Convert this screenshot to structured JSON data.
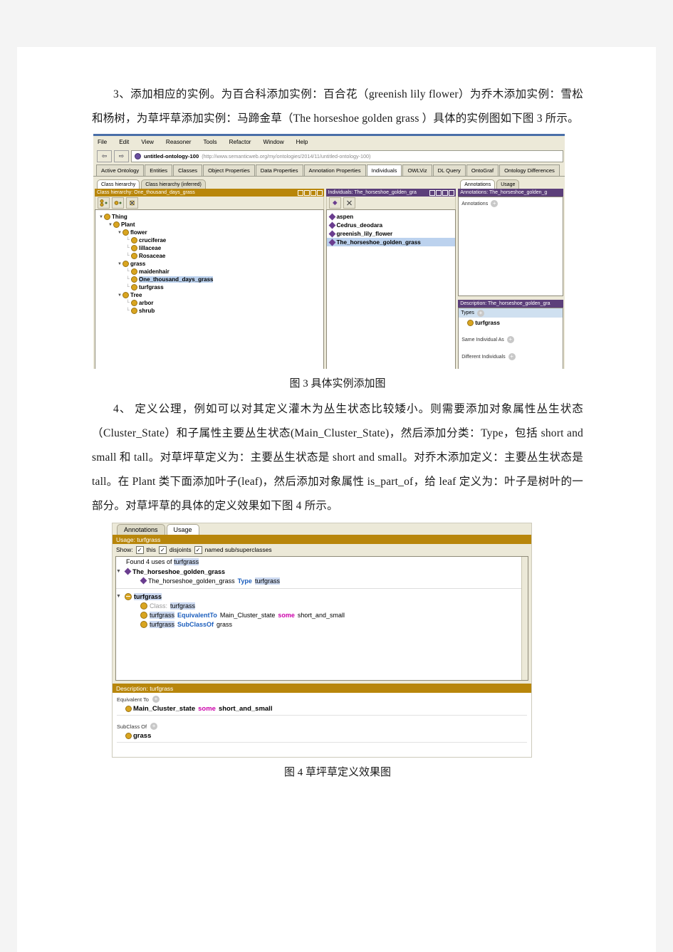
{
  "document": {
    "paragraphs": [
      {
        "id": "para-3",
        "runs": [
          {
            "t": "indent",
            "v": ""
          },
          {
            "t": "cn",
            "v": "3、添加相应的实例。为百合科添加实例："
          },
          {
            "t": "cn",
            "v": "百合花（"
          },
          {
            "t": "en",
            "v": "greenish lily flower"
          },
          {
            "t": "cn",
            "v": "）为乔木添加实例：雪松和杨树，为草坪草添加实例：马蹄金草（"
          },
          {
            "t": "en",
            "v": "The horseshoe golden grass"
          },
          {
            "t": "cn",
            "v": "）具体的实例图如下图 3 所示。"
          }
        ],
        "plain": "3、添加相应的实例。为百合科添加实例：百合花（greenish lily flower）为乔木添加实例：雪松和杨树，为草坪草添加实例：马蹄金草（The horseshoe golden grass ）具体的实例图如下图 3 所示。"
      },
      {
        "id": "para-4",
        "plain": "4、 定义公理，例如可以对其定义灌木为丛生状态比较矮小。则需要添加对象属性丛生状态（Cluster_State）和子属性主要丛生状态(Main_Cluster_State)，然后添加分类：Type，包括 short and small 和 tall。对草坪草定义为：主要丛生状态是 short and small。对乔木添加定义：主要丛生状态是 tall。在 Plant 类下面添加叶子(leaf)，然后添加对象属性 is_part_of，给 leaf 定义为：叶子是树叶的一部分。对草坪草的具体的定义效果如下图 4 所示。"
      }
    ],
    "captions": {
      "fig3": "图 3  具体实例添加图",
      "fig4": "图 4  草坪草定义效果图"
    }
  },
  "figure3": {
    "menubar": [
      "File",
      "Edit",
      "View",
      "Reasoner",
      "Tools",
      "Refactor",
      "Window",
      "Help"
    ],
    "nav": {
      "back_icon": "arrow-left-icon",
      "forward_icon": "arrow-right-icon"
    },
    "ontology": {
      "icon": "ontology-icon",
      "name": "untitled-ontology-100",
      "iri": "(http://www.semanticweb.org/my/ontologies/2014/11/untitled-ontology-100)"
    },
    "tabs": [
      {
        "label": "Active Ontology",
        "active": false
      },
      {
        "label": "Entities",
        "active": false
      },
      {
        "label": "Classes",
        "active": false
      },
      {
        "label": "Object Properties",
        "active": false
      },
      {
        "label": "Data Properties",
        "active": false
      },
      {
        "label": "Annotation Properties",
        "active": false
      },
      {
        "label": "Individuals",
        "active": true
      },
      {
        "label": "OWLViz",
        "active": false
      },
      {
        "label": "DL Query",
        "active": false
      },
      {
        "label": "OntoGraf",
        "active": false
      },
      {
        "label": "Ontology Differences",
        "active": false
      }
    ],
    "class_panel": {
      "tabs": [
        {
          "label": "Class hierarchy",
          "active": true
        },
        {
          "label": "Class hierarchy (inferred)",
          "active": false
        }
      ],
      "title": "Class hierarchy: One_thousand_days_grass",
      "toolbar": [
        "add-subclass-icon",
        "add-sibling-class-icon",
        "delete-class-icon"
      ],
      "tree": [
        {
          "label": "Thing",
          "depth": 0,
          "expander": "▼",
          "selected": false
        },
        {
          "label": "Plant",
          "depth": 1,
          "expander": "▼",
          "selected": false
        },
        {
          "label": "flower",
          "depth": 2,
          "expander": "▼",
          "selected": false
        },
        {
          "label": "cruciferae",
          "depth": 3,
          "expander": "",
          "selected": false
        },
        {
          "label": "lillaceae",
          "depth": 3,
          "expander": "",
          "selected": false
        },
        {
          "label": "Rosaceae",
          "depth": 3,
          "expander": "",
          "selected": false
        },
        {
          "label": "grass",
          "depth": 2,
          "expander": "▼",
          "selected": false
        },
        {
          "label": "maidenhair",
          "depth": 3,
          "expander": "",
          "selected": false
        },
        {
          "label": "One_thousand_days_grass",
          "depth": 3,
          "expander": "",
          "selected": true
        },
        {
          "label": "turfgrass",
          "depth": 3,
          "expander": "",
          "selected": false
        },
        {
          "label": "Tree",
          "depth": 2,
          "expander": "▼",
          "selected": false
        },
        {
          "label": "arbor",
          "depth": 3,
          "expander": "",
          "selected": false
        },
        {
          "label": "shrub",
          "depth": 3,
          "expander": "",
          "selected": false
        }
      ]
    },
    "individuals_panel": {
      "title": "Individuals: The_horseshoe_golden_gra",
      "toolbar": [
        "add-individual-icon",
        "delete-individual-icon"
      ],
      "items": [
        {
          "label": "aspen",
          "selected": false
        },
        {
          "label": "Cedrus_deodara",
          "selected": false
        },
        {
          "label": "greenish_lily_flower",
          "selected": false
        },
        {
          "label": "The_horseshoe_golden_grass",
          "selected": true
        }
      ]
    },
    "annotations_panel": {
      "tabs": [
        {
          "label": "Annotations",
          "active": true
        },
        {
          "label": "Usage",
          "active": false
        }
      ],
      "title": "Annotations: The_horseshoe_golden_g",
      "section_label": "Annotations"
    },
    "description_panel": {
      "title": "Description: The_horseshoe_golden_gra",
      "types_label": "Types",
      "types_value": "turfgrass",
      "same_individual_label": "Same Individual As",
      "different_individuals_label": "Different Individuals"
    }
  },
  "figure4": {
    "tabs": [
      {
        "label": "Annotations",
        "active": false
      },
      {
        "label": "Usage",
        "active": true
      }
    ],
    "usage_title": "Usage: turfgrass",
    "show_label": "Show:",
    "show_options": [
      {
        "label": "this",
        "checked": true
      },
      {
        "label": "disjoints",
        "checked": true
      },
      {
        "label": "named sub/superclasses",
        "checked": true
      }
    ],
    "found_prefix": "Found 4 uses of",
    "found_term": "turfgrass",
    "usage_tree": [
      {
        "root": "The_horseshoe_golden_grass",
        "root_icon": "individual-diamond-icon",
        "children": [
          {
            "icon": "individual-diamond-icon",
            "parts": [
              {
                "t": "plain",
                "v": "The_horseshoe_golden_grass"
              },
              {
                "t": "kw",
                "v": "Type"
              },
              {
                "t": "hl",
                "v": "turfgrass"
              }
            ]
          }
        ]
      },
      {
        "root": "turfgrass",
        "root_icon": "class-circle-icon",
        "children": [
          {
            "icon": "class-circle-icon",
            "parts": [
              {
                "t": "gray",
                "v": "Class:"
              },
              {
                "t": "hl",
                "v": "turfgrass"
              }
            ]
          },
          {
            "icon": "class-circle-icon",
            "parts": [
              {
                "t": "hl",
                "v": "turfgrass"
              },
              {
                "t": "kw",
                "v": "EquivalentTo"
              },
              {
                "t": "plain",
                "v": "Main_Cluster_state"
              },
              {
                "t": "pink",
                "v": "some"
              },
              {
                "t": "plain",
                "v": "short_and_small"
              }
            ]
          },
          {
            "icon": "class-circle-icon",
            "parts": [
              {
                "t": "hl",
                "v": "turfgrass"
              },
              {
                "t": "kw",
                "v": "SubClassOf"
              },
              {
                "t": "plain",
                "v": "grass"
              }
            ]
          }
        ]
      }
    ],
    "description_title": "Description: turfgrass",
    "equivalent_to_label": "Equivalent To",
    "equivalent_to_value": [
      {
        "t": "plain",
        "v": "Main_Cluster_state"
      },
      {
        "t": "pink",
        "v": "some"
      },
      {
        "t": "plain",
        "v": "short_and_small"
      }
    ],
    "subclass_of_label": "SubClass Of",
    "subclass_of_value": "grass"
  },
  "colors": {
    "protege_bg": "#ece9d8",
    "title_gold": "#b8860b",
    "title_purple": "#5c3f7a",
    "class_dot": "#d9a520",
    "individual_dot": "#6a3d8f",
    "selection": "#bcd2ee",
    "keyword_blue": "#1d5fbd",
    "keyword_pink": "#cc00aa"
  }
}
